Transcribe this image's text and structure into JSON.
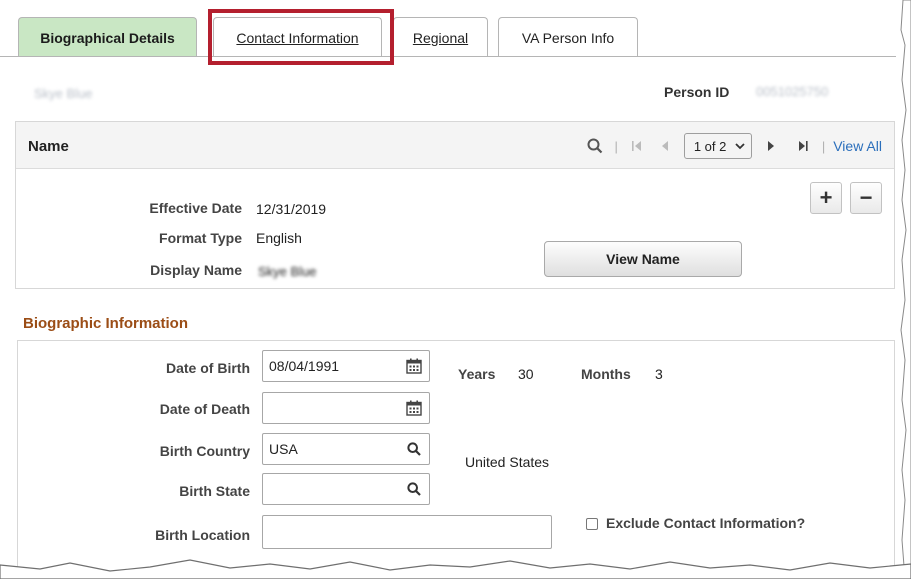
{
  "tabs": [
    {
      "label": "Biographical Details",
      "active": true
    },
    {
      "label": "Contact Information",
      "active": false
    },
    {
      "label": "Regional",
      "active": false
    },
    {
      "label": "VA Person Info",
      "active": false
    }
  ],
  "person": {
    "name": "Skye Blue",
    "id_label": "Person ID",
    "id_value": "0051025750"
  },
  "name_panel": {
    "title": "Name",
    "pager": "1 of 2",
    "view_all": "View All",
    "effective_date_label": "Effective Date",
    "effective_date": "12/31/2019",
    "format_type_label": "Format Type",
    "format_type": "English",
    "display_name_label": "Display Name",
    "display_name": "Skye Blue",
    "view_name_button": "View Name",
    "add_symbol": "+",
    "remove_symbol": "−"
  },
  "biographic": {
    "section_title": "Biographic Information",
    "dob_label": "Date of Birth",
    "dob_value": "08/04/1991",
    "years_label": "Years",
    "years_value": "30",
    "months_label": "Months",
    "months_value": "3",
    "dod_label": "Date of Death",
    "dod_value": "",
    "birth_country_label": "Birth Country",
    "birth_country_value": "USA",
    "birth_country_desc": "United States",
    "birth_state_label": "Birth State",
    "birth_state_value": "",
    "birth_location_label": "Birth Location",
    "birth_location_value": "",
    "exclude_label": "Exclude Contact Information?"
  },
  "colors": {
    "active_tab": "#c9e7c4",
    "highlight": "#b41f2e",
    "section_title": "#9b4d16",
    "link": "#2a6ebb"
  }
}
